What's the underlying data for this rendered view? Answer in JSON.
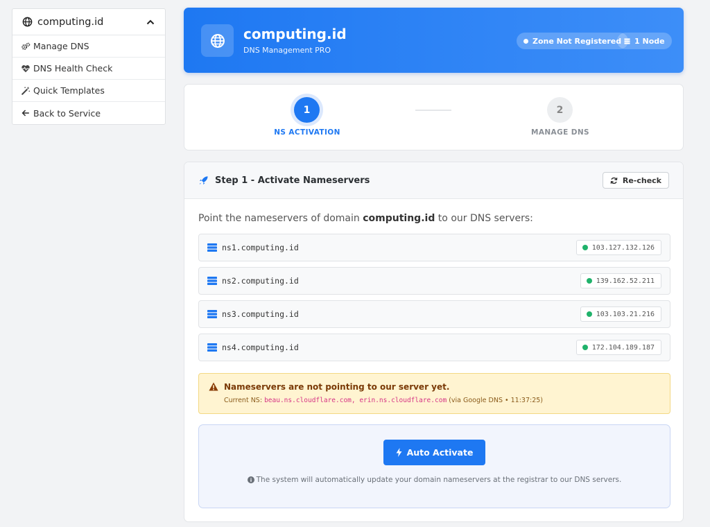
{
  "sidebar": {
    "title": "computing.id",
    "items": [
      {
        "label": "Manage DNS"
      },
      {
        "label": "DNS Health Check"
      },
      {
        "label": "Quick Templates"
      },
      {
        "label": "Back to Service"
      }
    ]
  },
  "header": {
    "title": "computing.id",
    "subtitle": "DNS Management PRO",
    "zone_badge": "Zone Not Registered",
    "node_badge": "1 Node"
  },
  "stepper": {
    "steps": [
      {
        "number": "1",
        "label": "NS ACTIVATION"
      },
      {
        "number": "2",
        "label": "MANAGE DNS"
      }
    ]
  },
  "main": {
    "title": "Step 1 - Activate Nameservers",
    "recheck_label": "Re-check",
    "intro_prefix": "Point the nameservers of domain ",
    "intro_domain": "computing.id",
    "intro_suffix": " to our DNS servers:",
    "nameservers": [
      {
        "name": "ns1.computing.id",
        "ip": "103.127.132.126"
      },
      {
        "name": "ns2.computing.id",
        "ip": "139.162.52.211"
      },
      {
        "name": "ns3.computing.id",
        "ip": "103.103.21.216"
      },
      {
        "name": "ns4.computing.id",
        "ip": "172.104.189.187"
      }
    ],
    "warning": {
      "title": "Nameservers are not pointing to our server yet.",
      "current_label": "Current NS: ",
      "current_ns": "beau.ns.cloudflare.com, erin.ns.cloudflare.com",
      "source": " (via Google DNS • 11:37:25)"
    },
    "auto": {
      "button_label": "Auto Activate",
      "note": "The system will automatically update your domain nameservers at the registrar to our DNS servers."
    }
  },
  "colors": {
    "accent": "#1e78f2",
    "status_ok": "#20b26b",
    "warning_bg": "#fff4d1"
  }
}
